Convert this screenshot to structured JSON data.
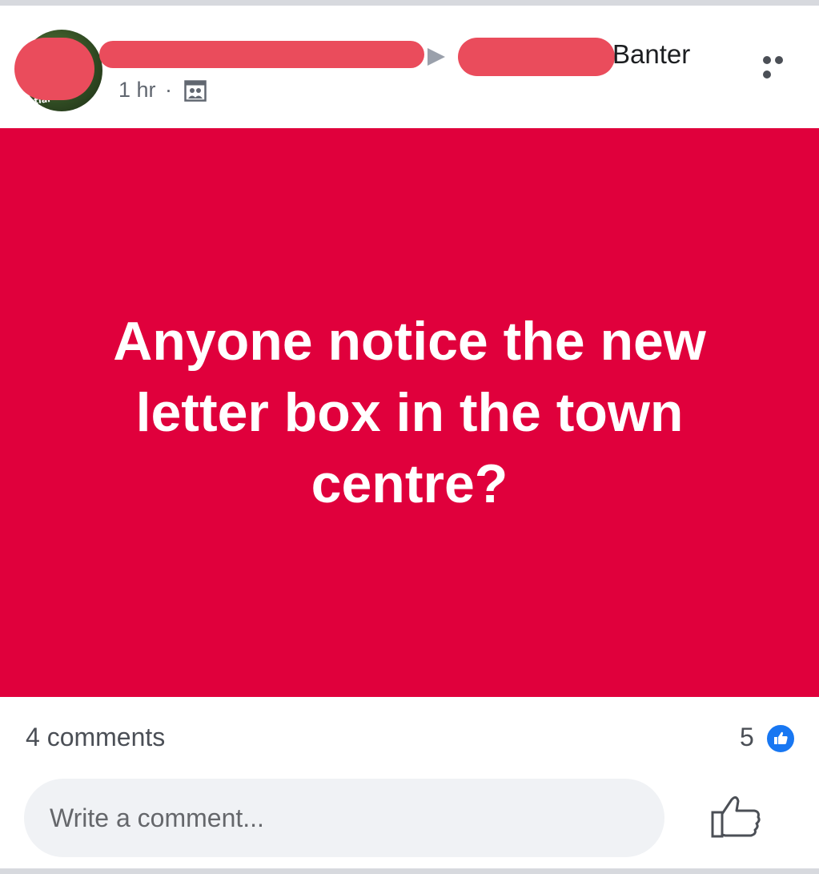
{
  "post": {
    "group_name": "Banter",
    "timestamp": "1 hr",
    "separator": "·",
    "audience_icon": "group-icon",
    "avatar_text": "ost\nntial",
    "message": "Anyone notice the new letter box in the town centre?",
    "background_color": "#e0003c",
    "more_icon": "more-options-icon"
  },
  "footer": {
    "comments_label": "4 comments",
    "reaction_count": "5",
    "reaction_icon": "like-badge-icon",
    "comment_placeholder": "Write a comment...",
    "like_icon": "thumbs-up-icon"
  },
  "colors": {
    "post_background": "#e0003c",
    "redaction": "#ea4c5c",
    "like_blue": "#1877f2"
  }
}
